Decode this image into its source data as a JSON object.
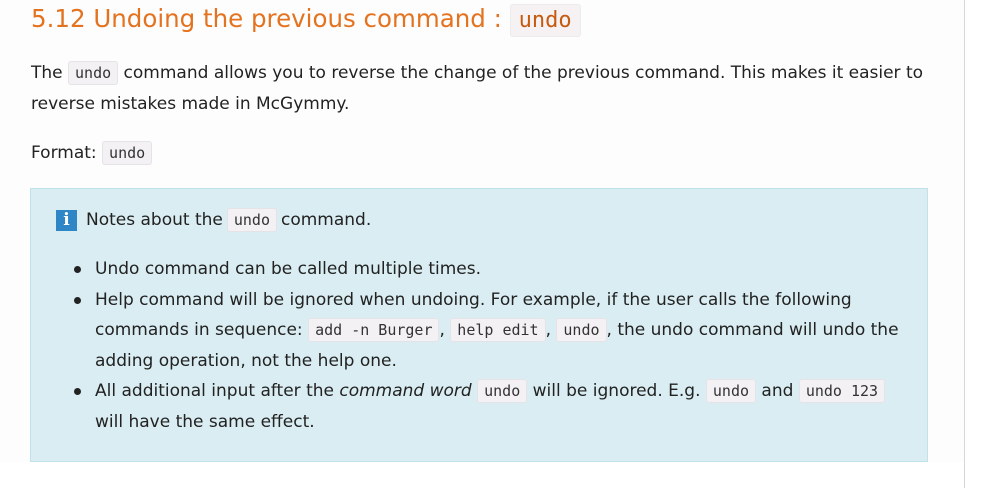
{
  "heading": {
    "text": "5.12 Undoing the previous command : ",
    "code": "undo"
  },
  "intro": {
    "pre": "The ",
    "code": "undo",
    "post": " command allows you to reverse the change of the previous command. This makes it easier to reverse mistakes made in McGymmy."
  },
  "format": {
    "label": "Format: ",
    "code": "undo"
  },
  "notes": {
    "icon": "info-icon",
    "title_pre": "Notes about the ",
    "title_code": "undo",
    "title_post": " command.",
    "items": [
      {
        "text": "Undo command can be called multiple times."
      },
      {
        "t1": "Help command will be ignored when undoing. For example, if the user calls the following commands in sequence: ",
        "c1": "add -n Burger",
        "t2": ", ",
        "c2": "help edit",
        "t3": ", ",
        "c3": "undo",
        "t4": ", the undo command will undo the adding operation, not the help one."
      },
      {
        "t1": "All additional input after the ",
        "em": "command word",
        "t2": " ",
        "c1": "undo",
        "t3": " will be ignored. E.g. ",
        "c2": "undo",
        "t4": " and ",
        "c3": "undo 123",
        "t5": " will have the same effect."
      }
    ]
  },
  "colors": {
    "heading": "#e4731f",
    "heading_code": "#c55a11",
    "notes_background": "#d9edf2",
    "info_icon": "#2f86c6"
  }
}
